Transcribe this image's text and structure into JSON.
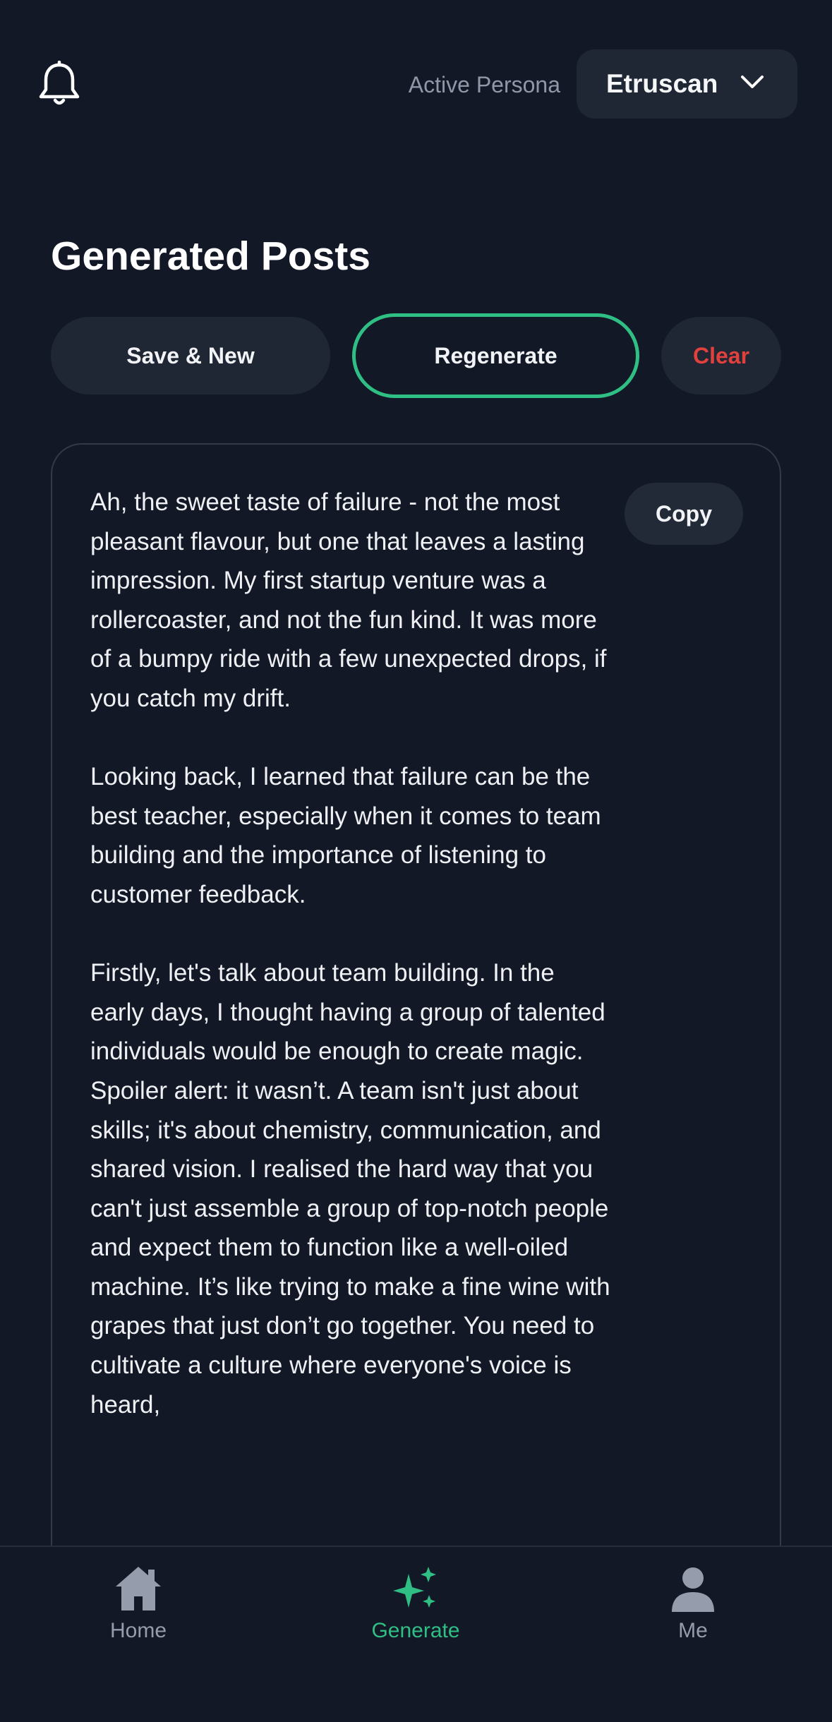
{
  "header": {
    "active_persona_label": "Active Persona",
    "persona_value": "Etruscan"
  },
  "page_title": "Generated Posts",
  "actions": {
    "save_new": "Save & New",
    "regenerate": "Regenerate",
    "clear": "Clear"
  },
  "post": {
    "copy_label": "Copy",
    "paragraphs": [
      "Ah, the sweet taste of failure - not the most pleasant flavour, but one that leaves a lasting impression. My first startup venture was a rollercoaster, and not the fun kind. It was more of a bumpy ride with a few unexpected drops, if you catch my drift.",
      "Looking back, I learned that failure can be the best teacher, especially when it comes to team building and the importance of listening to customer feedback.",
      "Firstly, let's talk about team building. In the early days, I thought having a group of talented individuals would be enough to create magic. Spoiler alert: it wasn’t. A team isn't just about skills; it's about chemistry, communication, and shared vision. I realised the hard way that you can't just assemble a group of top-notch people and expect them to function like a well-oiled machine. It’s like trying to make a fine wine with grapes that just don’t go together. You need to cultivate a culture where everyone's voice is heard,"
    ]
  },
  "nav": {
    "home": "Home",
    "generate": "Generate",
    "me": "Me"
  },
  "colors": {
    "background": "#131826",
    "surface": "#1f2634",
    "accent": "#2fbf84",
    "danger": "#e0413d",
    "muted": "#959dad"
  }
}
